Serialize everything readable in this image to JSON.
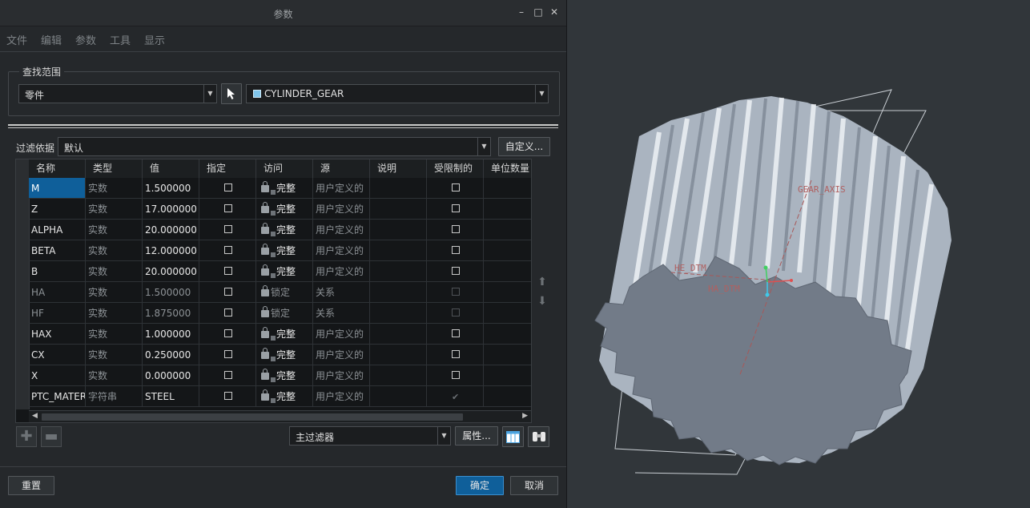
{
  "window": {
    "title": "参数"
  },
  "menu": [
    "文件",
    "编辑",
    "参数",
    "工具",
    "显示"
  ],
  "scope": {
    "legend": "查找范围",
    "type_value": "零件",
    "model_value": "CYLINDER_GEAR"
  },
  "filter": {
    "label": "过滤依据",
    "value": "默认",
    "customize_label": "自定义..."
  },
  "table": {
    "columns": [
      "名称",
      "类型",
      "值",
      "指定",
      "访问",
      "源",
      "说明",
      "受限制的",
      "单位数量"
    ],
    "rows": [
      {
        "name": "M",
        "type": "实数",
        "value": "1.500000",
        "access": "完整",
        "source": "用户定义的",
        "locked": false,
        "restricted": "unchecked"
      },
      {
        "name": "Z",
        "type": "实数",
        "value": "17.000000",
        "access": "完整",
        "source": "用户定义的",
        "locked": false,
        "restricted": "unchecked"
      },
      {
        "name": "ALPHA",
        "type": "实数",
        "value": "20.000000",
        "access": "完整",
        "source": "用户定义的",
        "locked": false,
        "restricted": "unchecked"
      },
      {
        "name": "BETA",
        "type": "实数",
        "value": "12.000000",
        "access": "完整",
        "source": "用户定义的",
        "locked": false,
        "restricted": "unchecked"
      },
      {
        "name": "B",
        "type": "实数",
        "value": "20.000000",
        "access": "完整",
        "source": "用户定义的",
        "locked": false,
        "restricted": "unchecked"
      },
      {
        "name": "HA",
        "type": "实数",
        "value": "1.500000",
        "access": "锁定",
        "source": "关系",
        "locked": true,
        "restricted": "disabled"
      },
      {
        "name": "HF",
        "type": "实数",
        "value": "1.875000",
        "access": "锁定",
        "source": "关系",
        "locked": true,
        "restricted": "disabled"
      },
      {
        "name": "HAX",
        "type": "实数",
        "value": "1.000000",
        "access": "完整",
        "source": "用户定义的",
        "locked": false,
        "restricted": "unchecked"
      },
      {
        "name": "CX",
        "type": "实数",
        "value": "0.250000",
        "access": "完整",
        "source": "用户定义的",
        "locked": false,
        "restricted": "unchecked"
      },
      {
        "name": "X",
        "type": "实数",
        "value": "0.000000",
        "access": "完整",
        "source": "用户定义的",
        "locked": false,
        "restricted": "unchecked"
      },
      {
        "name": "PTC_MATERIAL_NAME",
        "type": "字符串",
        "value": "STEEL",
        "access": "完整",
        "source": "用户定义的",
        "locked": false,
        "restricted": "checked-disabled"
      }
    ]
  },
  "bottom": {
    "main_filter_value": "主过滤器",
    "properties_label": "属性..."
  },
  "footer": {
    "reset_label": "重置",
    "ok_label": "确定",
    "cancel_label": "取消"
  },
  "viewport": {
    "labels": [
      "GEAR_AXIS",
      "HE_DTM",
      "HA_DTM"
    ]
  },
  "colors": {
    "accent": "#0f5f9a",
    "dialog_bg": "#25282b",
    "viewport_bg": "#31363a",
    "gear_face": "#6e7785",
    "gear_teeth": "#b9c3cf"
  }
}
